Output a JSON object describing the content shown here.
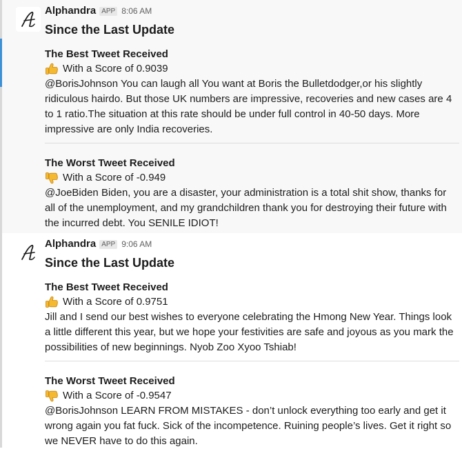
{
  "messages": [
    {
      "sender": "Alphandra",
      "badge": "APP",
      "time": "8:06 AM",
      "title": "Since the Last Update",
      "best": {
        "heading": "The Best Tweet Received",
        "icon": "thumbs-up-icon",
        "score_text": "With a Score of 0.9039",
        "text": "@BorisJohnson You can laugh all You want at Boris the Bulletdodger,or his slightly ridiculous hairdo. But those UK numbers are impressive, recoveries and new cases are 4 to 1 ratio.The situation at this rate should be under full control in 40-50 days. More impressive are only India recoveries."
      },
      "worst": {
        "heading": "The Worst Tweet Received",
        "icon": "thumbs-down-icon",
        "score_text": "With a Score of -0.949",
        "text": "@JoeBiden Biden, you are a disaster, your administration is a total shit show, thanks for all of the unemployment, and my grandchildren thank you for destroying their future with the incurred debt. You SENILE IDIOT!"
      }
    },
    {
      "sender": "Alphandra",
      "badge": "APP",
      "time": "9:06 AM",
      "title": "Since the Last Update",
      "best": {
        "heading": "The Best Tweet Received",
        "icon": "thumbs-up-icon",
        "score_text": "With a Score of 0.9751",
        "text": "Jill and I send our best wishes to everyone celebrating the Hmong New Year. Things look a little different this year, but we hope your festivities are safe and joyous as you mark the possibilities of new beginnings. Nyob Zoo Xyoo Tshiab!"
      },
      "worst": {
        "heading": "The Worst Tweet Received",
        "icon": "thumbs-down-icon",
        "score_text": "With a Score of -0.9547",
        "text": "@BorisJohnson LEARN FROM MISTAKES - don’t unlock everything too early and get it wrong again you fat fuck. Sick of the incompetence. Ruining people’s lives. Get it right so we NEVER have to do this again."
      }
    }
  ],
  "colors": {
    "emoji": "#f5b831",
    "emoji_dark": "#c8870f"
  }
}
